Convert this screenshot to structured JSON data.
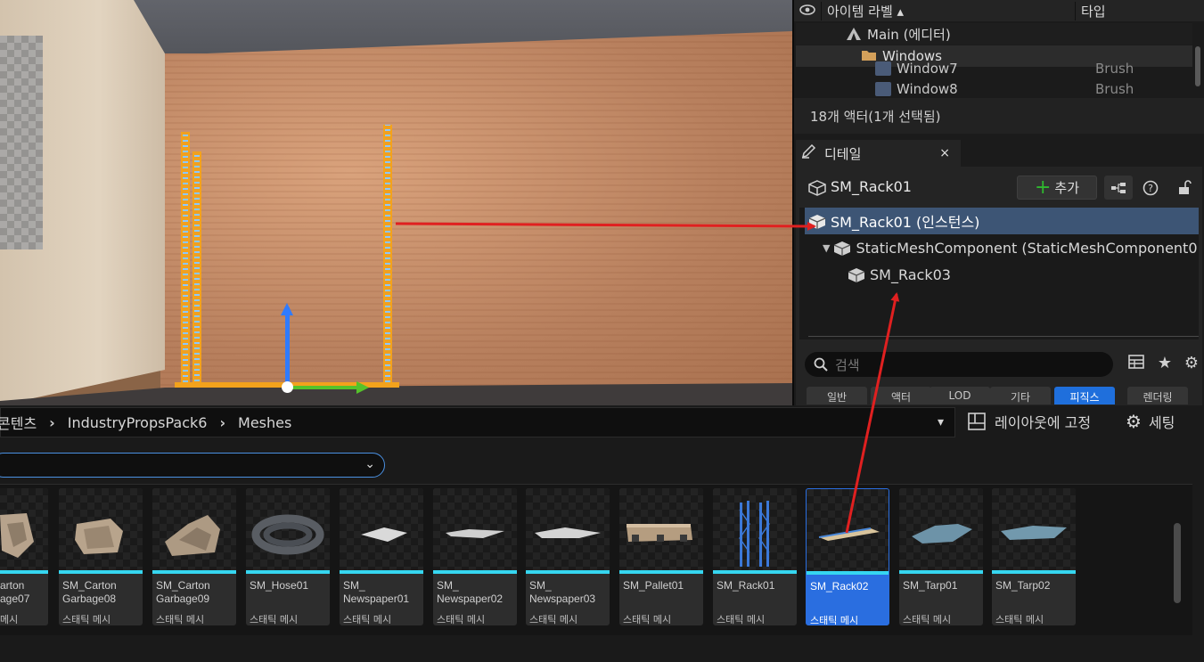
{
  "outliner": {
    "col_label": "아이템 라벨 ▴",
    "col_type": "타입",
    "rows": [
      {
        "label": "Main (에디터)",
        "type": "",
        "icon": "level-icon"
      },
      {
        "label": "Windows",
        "type": "",
        "icon": "folder-icon"
      },
      {
        "label": "Window7",
        "type": "Brush",
        "icon": "brush-icon"
      },
      {
        "label": "Window8",
        "type": "Brush",
        "icon": "brush-icon"
      }
    ],
    "footer": "18개 액터(1개 선택됨)"
  },
  "details": {
    "tab_label": "디테일",
    "close": "×",
    "actor_name": "SM_Rack01",
    "add_label": "추가",
    "components": [
      {
        "label": "SM_Rack01 (인스턴스)"
      },
      {
        "label": "StaticMeshComponent (StaticMeshComponent0"
      },
      {
        "label": "SM_Rack03"
      }
    ],
    "search_placeholder": "검색",
    "categories": [
      "일반",
      "액터",
      "LOD",
      "기타",
      "피직스",
      "렌더링"
    ],
    "active_category": "피직스"
  },
  "content_browser": {
    "path": [
      "콘텐츠",
      "IndustryPropsPack6",
      "Meshes"
    ],
    "lock_layout_label": "레이아웃에 고정",
    "settings_label": "세팅",
    "assets": [
      {
        "name": "arton\nage07",
        "type": "메시"
      },
      {
        "name": "SM_Carton\nGarbage08",
        "type": "스태틱 메시"
      },
      {
        "name": "SM_Carton\nGarbage09",
        "type": "스태틱 메시"
      },
      {
        "name": "SM_Hose01",
        "type": "스태틱 메시"
      },
      {
        "name": "SM_\nNewspaper01",
        "type": "스태틱 메시"
      },
      {
        "name": "SM_\nNewspaper02",
        "type": "스태틱 메시"
      },
      {
        "name": "SM_\nNewspaper03",
        "type": "스태틱 메시"
      },
      {
        "name": "SM_Pallet01",
        "type": "스태틱 메시"
      },
      {
        "name": "SM_Rack01",
        "type": "스태틱 메시"
      },
      {
        "name": "SM_Rack02",
        "type": "스태틱 메시"
      },
      {
        "name": "SM_Tarp01",
        "type": "스태틱 메시"
      },
      {
        "name": "SM_Tarp02",
        "type": "스태틱 메시"
      }
    ],
    "selected_asset": "SM_Rack02"
  },
  "colors": {
    "accent": "#1f6fdc",
    "selection_row": "#3d5575",
    "asset_bar": "#36d6f0",
    "annotation_arrow": "#e02020"
  }
}
